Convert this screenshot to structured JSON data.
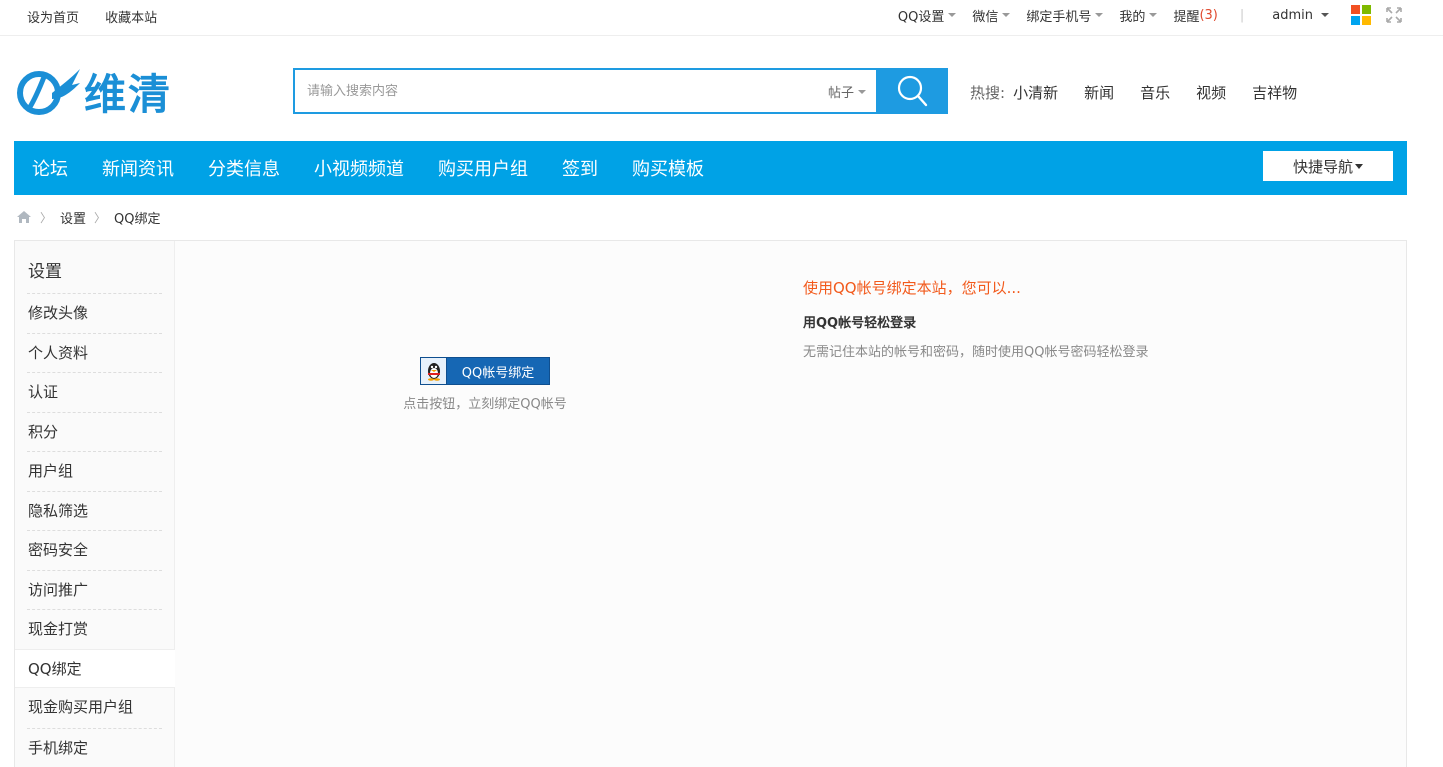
{
  "topbar": {
    "left_links": [
      "设为首页",
      "收藏本站"
    ],
    "qq_settings": "QQ设置",
    "wechat": "微信",
    "bind_phone": "绑定手机号",
    "mine": "我的",
    "remind": "提醒",
    "remind_count": "(3)",
    "separator": "|",
    "user": "admin"
  },
  "header": {
    "logo_text": "维清",
    "search_placeholder": "请输入搜索内容",
    "search_type": "帖子",
    "hot_label": "热搜:",
    "hot_links": [
      "小清新",
      "新闻",
      "音乐",
      "视频",
      "吉祥物"
    ]
  },
  "nav": {
    "items": [
      "论坛",
      "新闻资讯",
      "分类信息",
      "小视频频道",
      "购买用户组",
      "签到",
      "购买模板"
    ],
    "quick_nav": "快捷导航"
  },
  "breadcrumb": {
    "items": [
      "设置",
      "QQ绑定"
    ]
  },
  "sidebar": {
    "title": "设置",
    "items": [
      "修改头像",
      "个人资料",
      "认证",
      "积分",
      "用户组",
      "隐私筛选",
      "密码安全",
      "访问推广",
      "现金打赏",
      "QQ绑定",
      "现金购买用户组",
      "手机绑定"
    ],
    "active_index": 9
  },
  "content": {
    "qq_button": "QQ帐号绑定",
    "hint": "点击按钮，立刻绑定QQ帐号",
    "headline": "使用QQ帐号绑定本站，您可以...",
    "sub": "用QQ帐号轻松登录",
    "desc": "无需记住本站的帐号和密码，随时使用QQ帐号密码轻松登录"
  },
  "colors": {
    "nav": "#00a2e6",
    "accent": "#1e9be1",
    "headline": "#f25a1c",
    "qq_button": "#1667b4"
  }
}
